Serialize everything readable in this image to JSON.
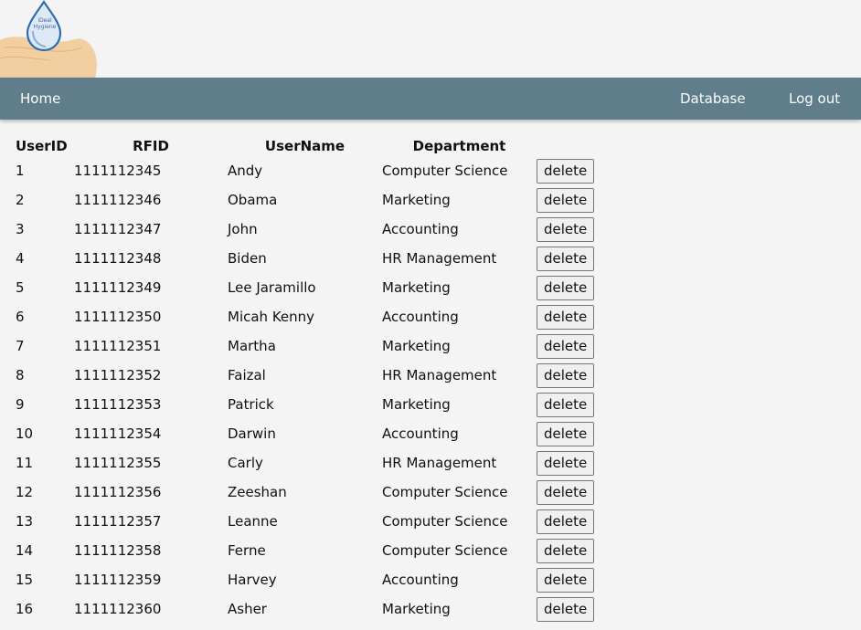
{
  "logo": {
    "icon": "hand-water-drop-logo",
    "text_line1": "iDeal",
    "text_line2": "Hygiene"
  },
  "nav": {
    "home": "Home",
    "database": "Database",
    "logout": "Log out",
    "bar_color": "#607d8b"
  },
  "table": {
    "headers": {
      "user_id": "UserID",
      "rfid": "RFID",
      "user_name": "UserName",
      "department": "Department"
    },
    "delete_label": "delete",
    "rows": [
      {
        "id": "1",
        "rfid": "1111112345",
        "name": "Andy",
        "dept": "Computer Science"
      },
      {
        "id": "2",
        "rfid": "1111112346",
        "name": "Obama",
        "dept": "Marketing"
      },
      {
        "id": "3",
        "rfid": "1111112347",
        "name": "John",
        "dept": "Accounting"
      },
      {
        "id": "4",
        "rfid": "1111112348",
        "name": "Biden",
        "dept": "HR Management"
      },
      {
        "id": "5",
        "rfid": "1111112349",
        "name": "Lee Jaramillo",
        "dept": "Marketing"
      },
      {
        "id": "6",
        "rfid": "1111112350",
        "name": "Micah Kenny",
        "dept": "Accounting"
      },
      {
        "id": "7",
        "rfid": "1111112351",
        "name": "Martha",
        "dept": "Marketing"
      },
      {
        "id": "8",
        "rfid": "1111112352",
        "name": "Faizal",
        "dept": "HR Management"
      },
      {
        "id": "9",
        "rfid": "1111112353",
        "name": "Patrick",
        "dept": "Marketing"
      },
      {
        "id": "10",
        "rfid": "1111112354",
        "name": "Darwin",
        "dept": "Accounting"
      },
      {
        "id": "11",
        "rfid": "1111112355",
        "name": "Carly",
        "dept": "HR Management"
      },
      {
        "id": "12",
        "rfid": "1111112356",
        "name": "Zeeshan",
        "dept": "Computer Science"
      },
      {
        "id": "13",
        "rfid": "1111112357",
        "name": "Leanne",
        "dept": "Computer Science"
      },
      {
        "id": "14",
        "rfid": "1111112358",
        "name": "Ferne",
        "dept": "Computer Science"
      },
      {
        "id": "15",
        "rfid": "1111112359",
        "name": "Harvey",
        "dept": "Accounting"
      },
      {
        "id": "16",
        "rfid": "1111112360",
        "name": "Asher",
        "dept": "Marketing"
      }
    ]
  }
}
